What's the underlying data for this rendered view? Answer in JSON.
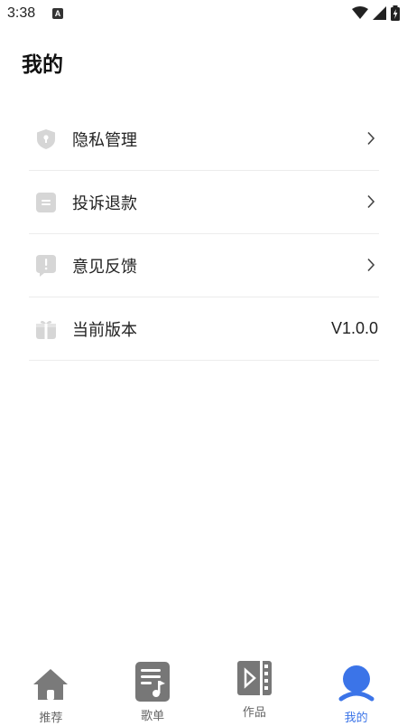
{
  "status_bar": {
    "time": "3:38",
    "notification_badge": "A",
    "icons": [
      "wifi-icon",
      "signal-icon",
      "battery-charging-icon"
    ]
  },
  "page": {
    "title": "我的"
  },
  "menu": {
    "items": [
      {
        "label": "隐私管理",
        "icon": "shield-icon",
        "trailing": "chevron-right-icon"
      },
      {
        "label": "投诉退款",
        "icon": "document-icon",
        "trailing": "chevron-right-icon"
      },
      {
        "label": "意见反馈",
        "icon": "feedback-icon",
        "trailing": "chevron-right-icon"
      },
      {
        "label": "当前版本",
        "icon": "gift-box-icon",
        "value": "V1.0.0"
      }
    ]
  },
  "tabbar": {
    "active_color": "#3b74e8",
    "inactive_color": "#777777",
    "tabs": [
      {
        "label": "推荐",
        "icon": "home-icon",
        "active": false
      },
      {
        "label": "歌单",
        "icon": "music-list-icon",
        "active": false
      },
      {
        "label": "作品",
        "icon": "video-work-icon",
        "active": false
      },
      {
        "label": "我的",
        "icon": "user-icon",
        "active": true
      }
    ]
  }
}
